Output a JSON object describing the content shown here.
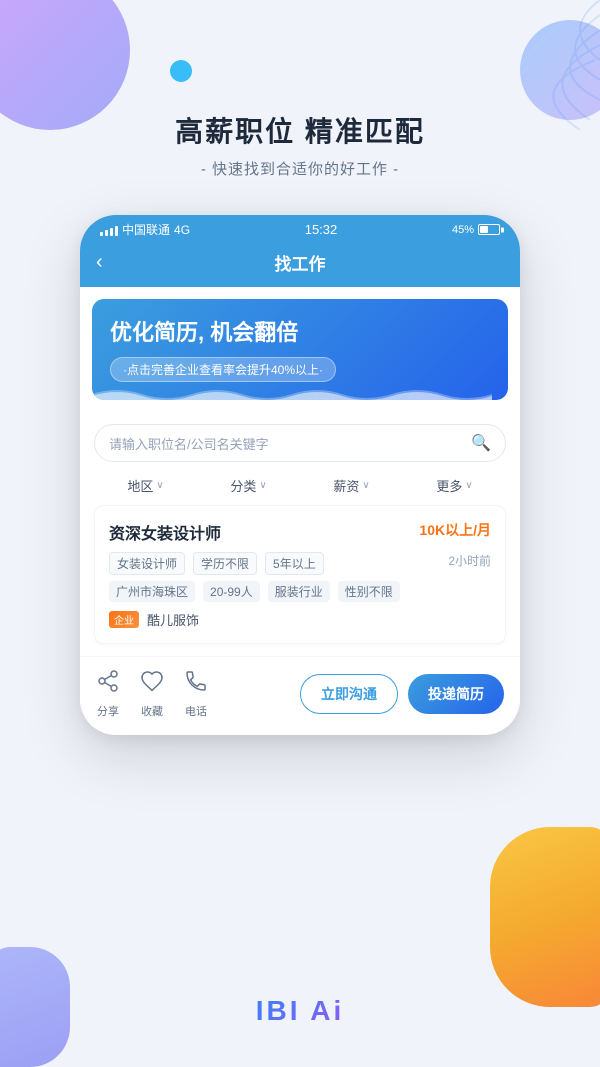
{
  "app": {
    "background_color": "#f0f4fa"
  },
  "header": {
    "headline": "高薪职位  精准匹配",
    "subheadline": "- 快速找到合适你的好工作 -"
  },
  "phone": {
    "status_bar": {
      "carrier": "中国联通",
      "network": "4G",
      "time": "15:32",
      "battery_percent": "45%"
    },
    "nav": {
      "back_icon": "‹",
      "title": "找工作"
    },
    "banner": {
      "title": "优化简历, 机会翻倍",
      "subtitle": "·点击完善企业查看率会提升40%以上·"
    },
    "search": {
      "placeholder": "请输入职位名/公司名关键字",
      "icon": "🔍"
    },
    "filters": [
      {
        "label": "地区",
        "icon": "∨"
      },
      {
        "label": "分类",
        "icon": "∨"
      },
      {
        "label": "薪资",
        "icon": "∨"
      },
      {
        "label": "更多",
        "icon": "∨"
      }
    ],
    "job_card": {
      "title": "资深女装设计师",
      "salary": "10K以上/月",
      "tags": [
        "女装设计师",
        "学历不限",
        "5年以上"
      ],
      "time": "2小时前",
      "location_tags": [
        "广州市海珠区",
        "20-99人",
        "服装行业",
        "性别不限"
      ],
      "company_badge": "企业",
      "company_name": "酷儿服饰"
    },
    "bottom_bar": {
      "actions": [
        {
          "icon": "✦",
          "label": "分享"
        },
        {
          "icon": "♡",
          "label": "收藏"
        },
        {
          "icon": "☎",
          "label": "电话"
        }
      ],
      "btn_communicate": "立即沟通",
      "btn_apply": "投递简历"
    }
  },
  "logo": {
    "text": "IBI Ai"
  }
}
